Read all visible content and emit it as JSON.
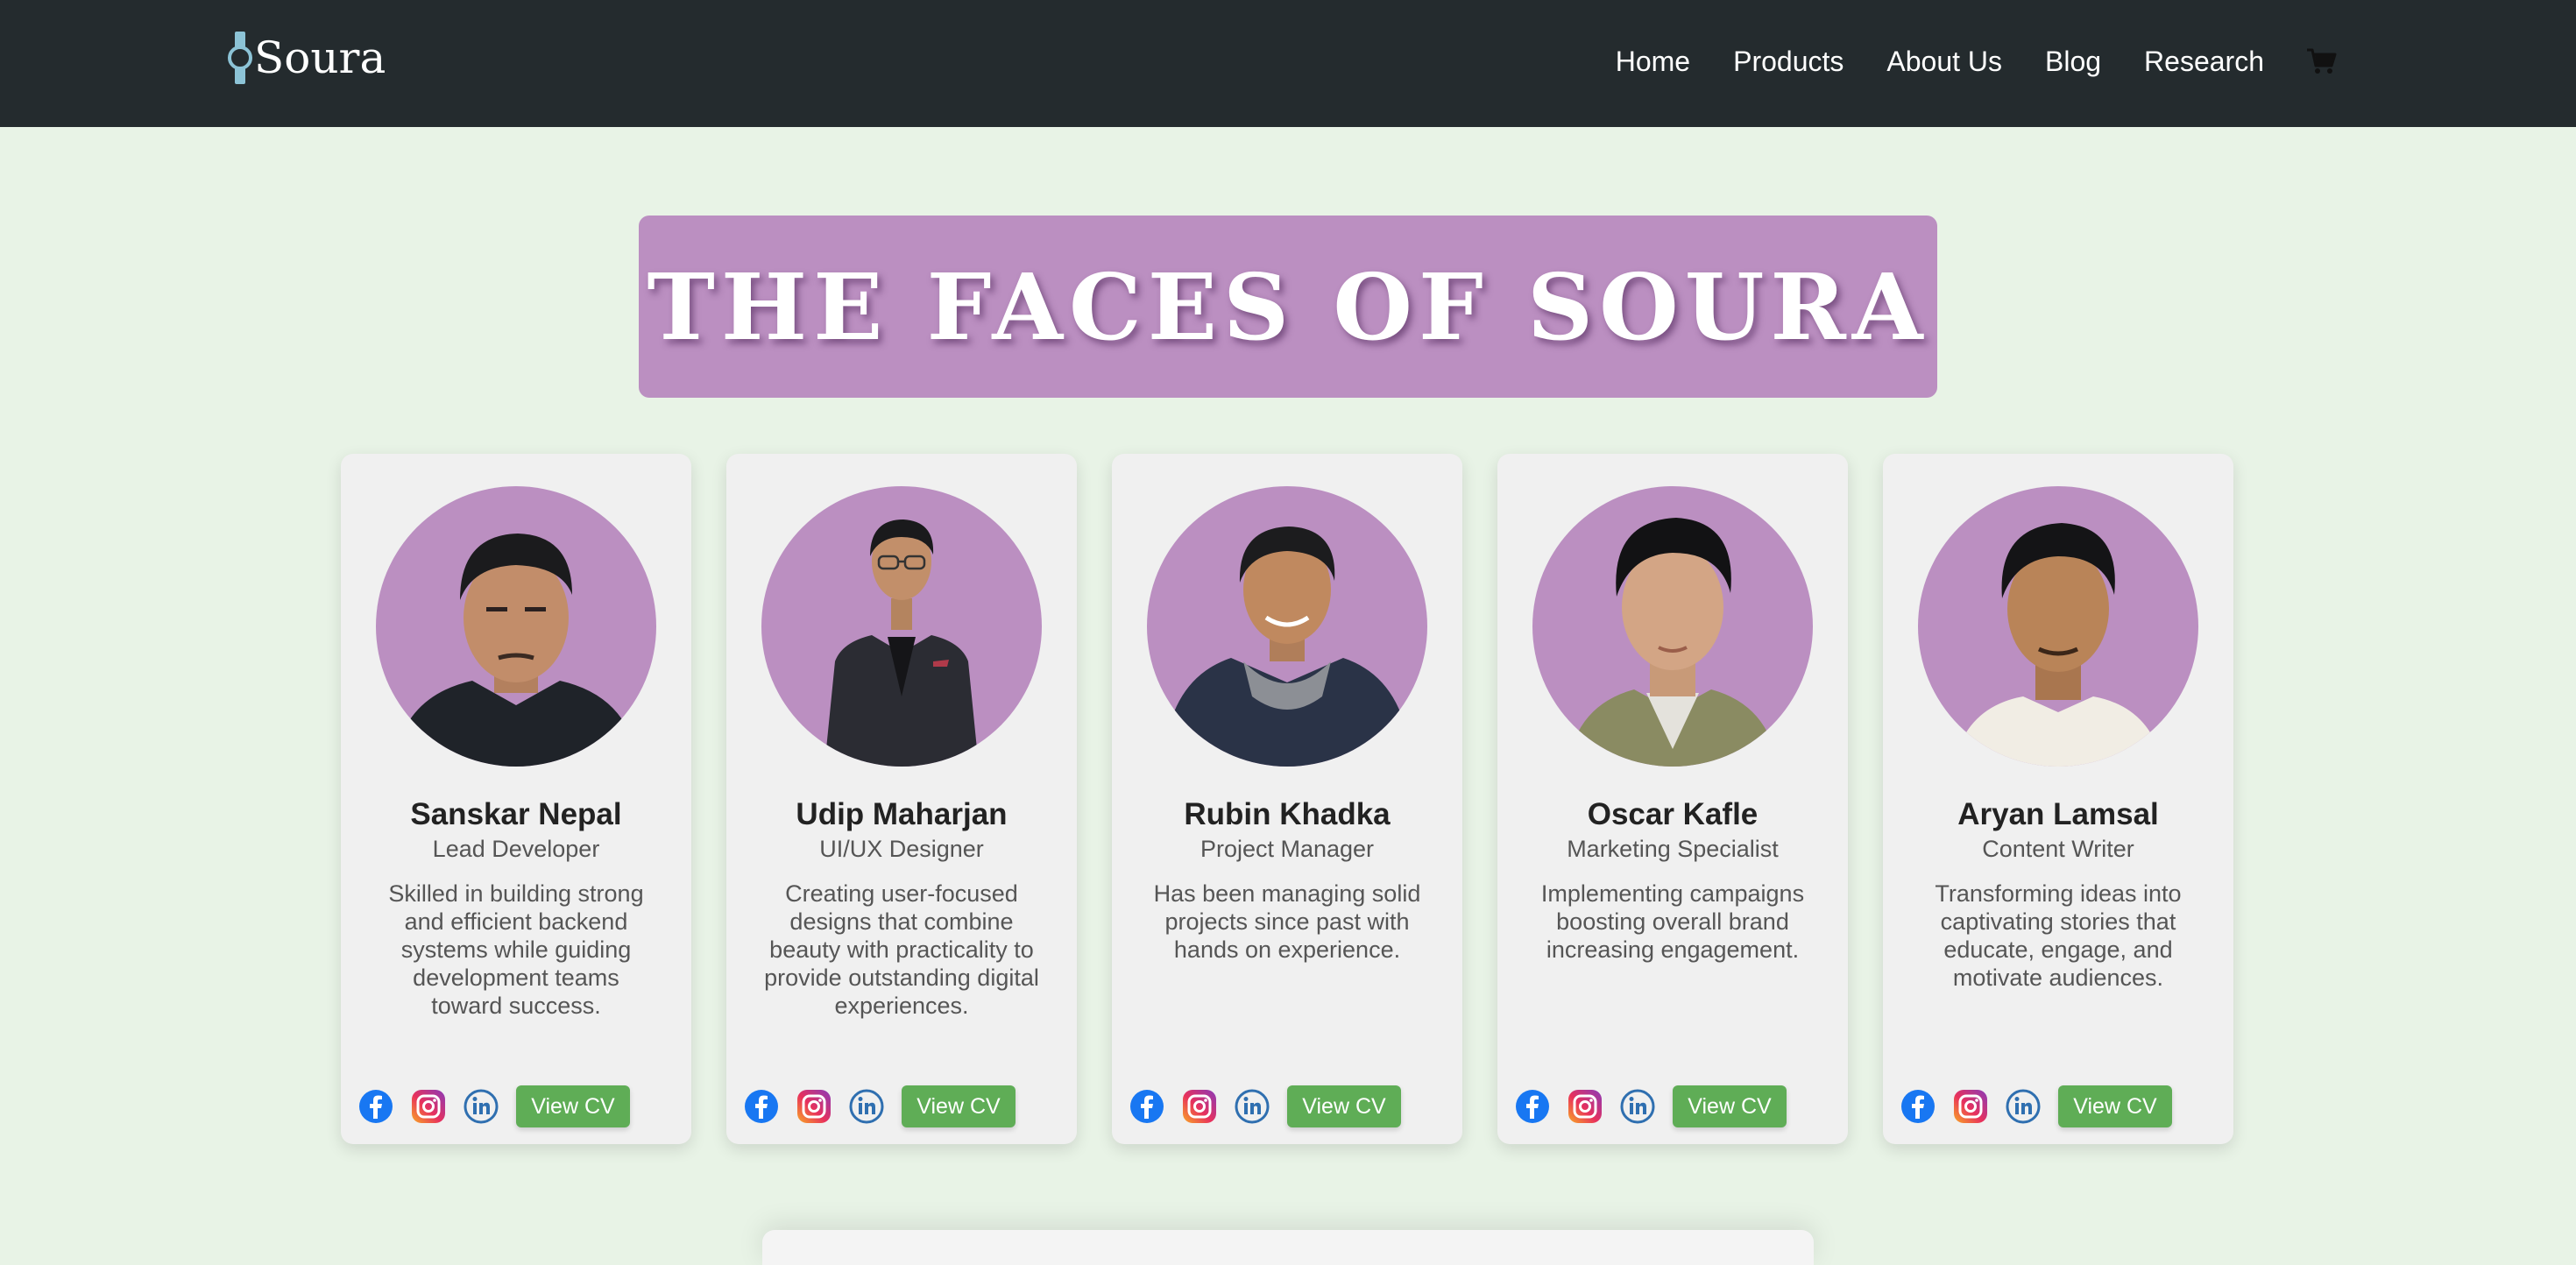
{
  "brand": {
    "name": "Soura",
    "logo_icon": "watch-icon",
    "logo_color": "#8cc3d6"
  },
  "nav": {
    "items": [
      {
        "label": "Home"
      },
      {
        "label": "Products"
      },
      {
        "label": "About Us"
      },
      {
        "label": "Blog"
      },
      {
        "label": "Research"
      }
    ],
    "cart_icon": "cart-icon",
    "background": "#242b2e"
  },
  "banner": {
    "title": "THE FACES OF SOURA",
    "background": "#bb8fc1"
  },
  "team": [
    {
      "name": "Sanskar Nepal",
      "role": "Lead Developer",
      "bio": "Skilled in building strong and efficient backend systems while guiding development teams toward success.",
      "cv_label": "View CV"
    },
    {
      "name": "Udip Maharjan",
      "role": "UI/UX Designer",
      "bio": "Creating user-focused designs that combine beauty with practicality to provide outstanding digital experiences.",
      "cv_label": "View CV"
    },
    {
      "name": "Rubin Khadka",
      "role": "Project Manager",
      "bio": "Has been managing solid projects since past with hands on experience.",
      "cv_label": "View CV"
    },
    {
      "name": "Oscar Kafle",
      "role": "Marketing Specialist",
      "bio": "Implementing campaigns boosting overall brand increasing engagement.",
      "cv_label": "View CV"
    },
    {
      "name": "Aryan Lamsal",
      "role": "Content Writer",
      "bio": "Transforming ideas into captivating stories that educate, engage, and motivate audiences.",
      "cv_label": "View CV"
    }
  ],
  "social_icons": [
    "facebook-icon",
    "instagram-icon",
    "linkedin-icon"
  ],
  "colors": {
    "page_background": "#e8f3e6",
    "card_background": "#f0f0f0",
    "avatar_background": "#bb8fc1",
    "cv_button": "#5fad56",
    "facebook": "#1877f2",
    "linkedin": "#2f6fb0"
  }
}
